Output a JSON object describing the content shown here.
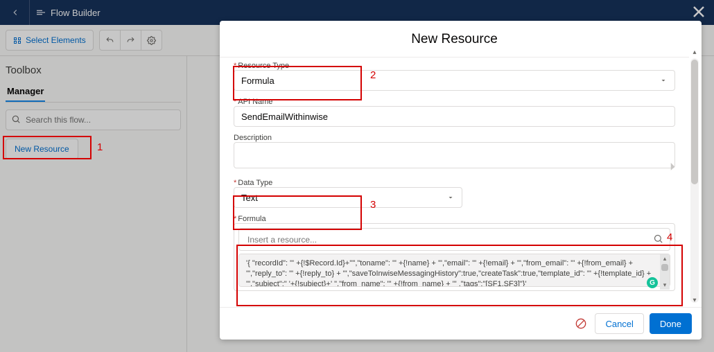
{
  "header": {
    "title": "Flow Builder"
  },
  "toolbar": {
    "select_elements": "Select Elements"
  },
  "sidebar": {
    "toolbox_title": "Toolbox",
    "tab_label": "Manager",
    "search_placeholder": "Search this flow...",
    "new_resource_label": "New Resource"
  },
  "modal": {
    "title": "New Resource",
    "resource_type_label": "Resource Type",
    "resource_type_value": "Formula",
    "api_name_label": "API Name",
    "api_name_value": "SendEmailWithinwise",
    "description_label": "Description",
    "description_value": "",
    "data_type_label": "Data Type",
    "data_type_value": "Text",
    "formula_label": "Formula",
    "resource_placeholder": "Insert a resource...",
    "formula_value": "'{ \"recordId\": \"' +{!$Record.Id}+'\"',\"toname\": \"' +{!name} + '\",\"email\": \"' +{!email} + '\",\"from_email\": \"' +{!from_email} + '\",\"reply_to\": \"' +{!reply_to} + '\",\"saveToInwiseMessagingHistory\":true,\"createTask\":true,\"template_id\": \"' +{!template_id} + '\",\"subject\":\" '+{!subject}+' \",\"from_name\": \"' +{!from_name} + '\" ,\"tags\":\"[SF1,SF3]\"}'",
    "cancel_label": "Cancel",
    "done_label": "Done"
  },
  "annotations": {
    "n1": "1",
    "n2": "2",
    "n3": "3",
    "n4": "4"
  }
}
